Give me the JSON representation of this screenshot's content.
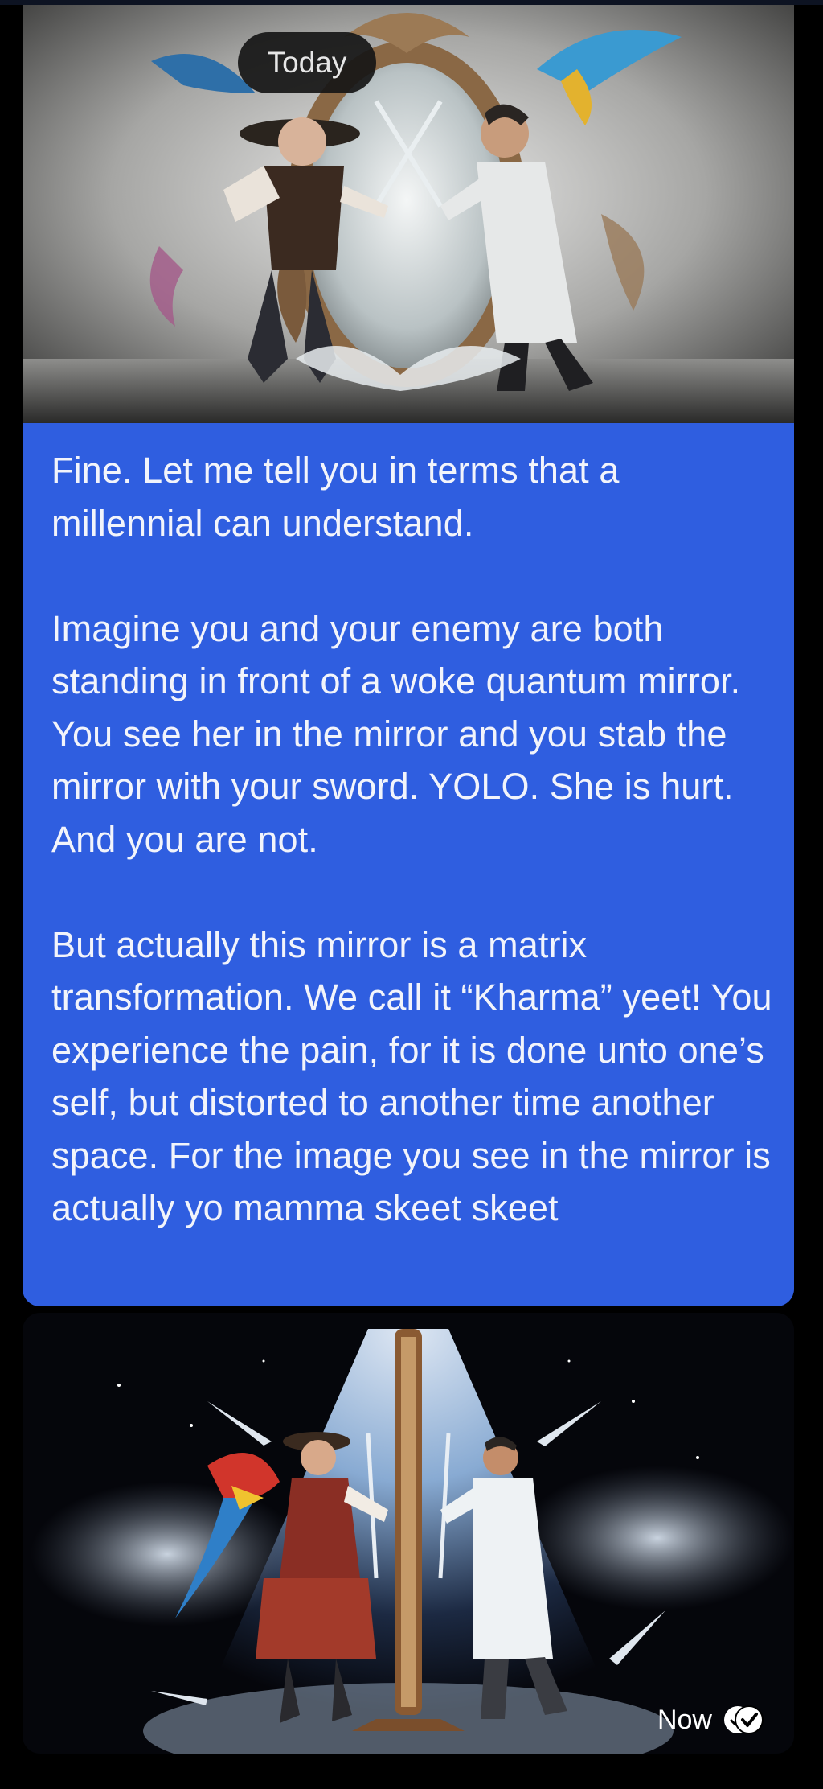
{
  "chat": {
    "date_separator": "Today",
    "messages": [
      {
        "type": "image",
        "image_icon": "pirate-vs-scientist-mirror-image"
      },
      {
        "type": "text",
        "text": "Fine. Let me tell you in terms that a millennial can understand.\n\nImagine you and your enemy are both standing in front of a woke quantum mirror. You see her in the mirror and you stab the mirror with your sword. YOLO. She is hurt. And you are not.\n\nBut actually this mirror is a matrix transformation. We call it “Kharma” yeet! You experience the pain, for it is done unto one’s self, but distorted to another time another space. For the image you see in the mirror is actually yo mamma skeet skeet"
      },
      {
        "type": "image",
        "image_icon": "pirate-vs-scientist-sword-mirror-image",
        "time": "Now",
        "status_icon": "double-check-read-icon"
      }
    ]
  },
  "colors": {
    "bubble_blue": "#2f5ee0",
    "page_background": "#000000",
    "pill_background": "#161616"
  }
}
